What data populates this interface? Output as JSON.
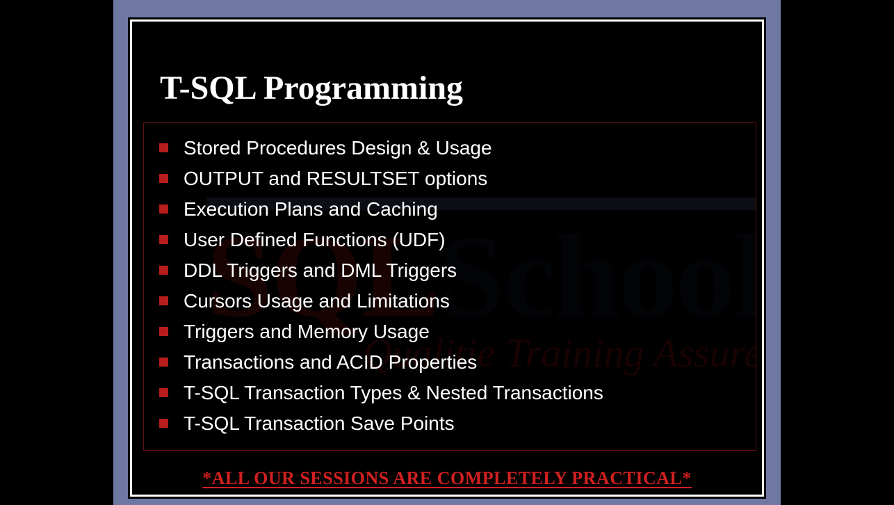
{
  "slide": {
    "title": "T-SQL Programming",
    "bullets": [
      "Stored Procedures Design & Usage",
      "OUTPUT and RESULTSET options",
      "Execution Plans and Caching",
      "User Defined Functions (UDF)",
      "DDL Triggers and DML Triggers",
      "Cursors Usage and Limitations",
      "Triggers and Memory Usage",
      "Transactions and ACID Properties",
      "T-SQL Transaction Types & Nested Transactions",
      "T-SQL Transaction Save Points"
    ],
    "footer": "*ALL OUR SESSIONS ARE COMPLETELY PRACTICAL*",
    "watermark": {
      "brand_left": "SQL",
      "brand_right": "School",
      "tagline": "Qualitie Training Assured"
    }
  }
}
